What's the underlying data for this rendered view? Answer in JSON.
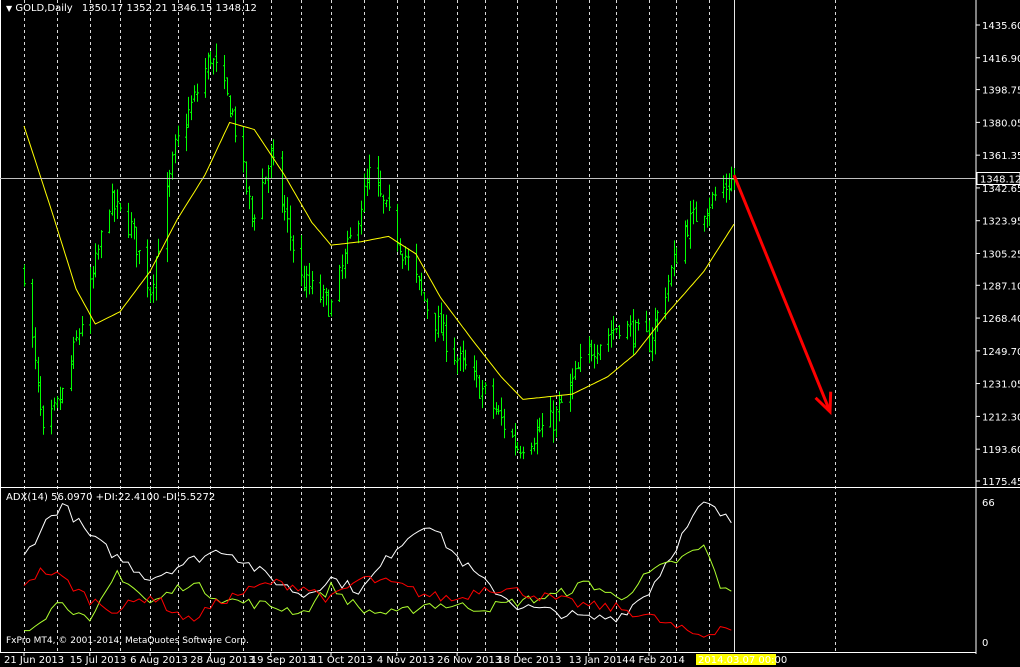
{
  "main_header": {
    "symbol": "GOLD,Daily",
    "ohlc": "1350.17 1352.21 1346.15 1348.12"
  },
  "indicator_header": {
    "label": "ADX(14) 56.0970 +DI:22.4100 -DI:5.5272"
  },
  "copyright": "FxPro MT4, © 2001-2014, MetaQuotes Software Corp.",
  "colors": {
    "background": "#000000",
    "candle_up": "#00ff00",
    "candle_down": "#00ff00",
    "moving_average": "#ffff00",
    "adx_line": "#ffffff",
    "plus_di_line": "#adff2f",
    "minus_di_line": "#ff0000",
    "arrow": "#ff0000",
    "grid": "#ffffff",
    "date_highlight": "#ffff00"
  },
  "current_price_label": "1348.12",
  "current_date_label": "2014.03.07 00:00",
  "chart_data": [
    {
      "type": "candlestick",
      "title": "GOLD,Daily",
      "ylim": [
        1175.45,
        1435.6
      ],
      "y_ticks": [
        "1435.60",
        "1416.90",
        "1398.75",
        "1380.05",
        "1361.35",
        "1342.65",
        "1323.95",
        "1305.25",
        "1287.10",
        "1268.40",
        "1249.70",
        "1231.05",
        "1212.30",
        "1193.60",
        "1175.45"
      ],
      "x_ticks": [
        "21 Jun 2013",
        "15 Jul 2013",
        "6 Aug 2013",
        "28 Aug 2013",
        "19 Sep 2013",
        "11 Oct 2013",
        "4 Nov 2013",
        "26 Nov 2013",
        "18 Dec 2013",
        "13 Jan 2014",
        "4 Feb 2014"
      ],
      "grid": "vertical dashed",
      "close_anchors": [
        {
          "date": "2013-06-21",
          "close": 1295
        },
        {
          "date": "2013-06-28",
          "close": 1200
        },
        {
          "date": "2013-07-05",
          "close": 1225
        },
        {
          "date": "2013-07-15",
          "close": 1285
        },
        {
          "date": "2013-07-22",
          "close": 1335
        },
        {
          "date": "2013-07-30",
          "close": 1320
        },
        {
          "date": "2013-08-06",
          "close": 1285
        },
        {
          "date": "2013-08-15",
          "close": 1365
        },
        {
          "date": "2013-08-28",
          "close": 1418
        },
        {
          "date": "2013-09-05",
          "close": 1385
        },
        {
          "date": "2013-09-12",
          "close": 1325
        },
        {
          "date": "2013-09-19",
          "close": 1360
        },
        {
          "date": "2013-09-30",
          "close": 1290
        },
        {
          "date": "2013-10-11",
          "close": 1275
        },
        {
          "date": "2013-10-25",
          "close": 1350
        },
        {
          "date": "2013-11-04",
          "close": 1315
        },
        {
          "date": "2013-11-15",
          "close": 1275
        },
        {
          "date": "2013-11-26",
          "close": 1245
        },
        {
          "date": "2013-12-06",
          "close": 1225
        },
        {
          "date": "2013-12-18",
          "close": 1195
        },
        {
          "date": "2013-12-31",
          "close": 1210
        },
        {
          "date": "2014-01-13",
          "close": 1250
        },
        {
          "date": "2014-01-24",
          "close": 1265
        },
        {
          "date": "2014-02-04",
          "close": 1255
        },
        {
          "date": "2014-02-17",
          "close": 1320
        },
        {
          "date": "2014-02-26",
          "close": 1335
        },
        {
          "date": "2014-03-07",
          "close": 1348.12
        }
      ],
      "moving_average_anchors": [
        {
          "date": "2013-06-21",
          "value": 1378
        },
        {
          "date": "2013-07-01",
          "value": 1330
        },
        {
          "date": "2013-07-10",
          "value": 1285
        },
        {
          "date": "2013-07-17",
          "value": 1265
        },
        {
          "date": "2013-07-26",
          "value": 1272
        },
        {
          "date": "2013-08-06",
          "value": 1295
        },
        {
          "date": "2013-08-16",
          "value": 1325
        },
        {
          "date": "2013-08-26",
          "value": 1350
        },
        {
          "date": "2013-09-04",
          "value": 1380
        },
        {
          "date": "2013-09-13",
          "value": 1376
        },
        {
          "date": "2013-09-24",
          "value": 1350
        },
        {
          "date": "2013-10-04",
          "value": 1323
        },
        {
          "date": "2013-10-11",
          "value": 1310
        },
        {
          "date": "2013-10-22",
          "value": 1312
        },
        {
          "date": "2013-11-01",
          "value": 1315
        },
        {
          "date": "2013-11-11",
          "value": 1305
        },
        {
          "date": "2013-11-20",
          "value": 1280
        },
        {
          "date": "2013-12-02",
          "value": 1255
        },
        {
          "date": "2013-12-12",
          "value": 1235
        },
        {
          "date": "2013-12-20",
          "value": 1222
        },
        {
          "date": "2014-01-07",
          "value": 1225
        },
        {
          "date": "2014-01-20",
          "value": 1235
        },
        {
          "date": "2014-01-30",
          "value": 1248
        },
        {
          "date": "2014-02-10",
          "value": 1270
        },
        {
          "date": "2014-02-24",
          "value": 1295
        },
        {
          "date": "2014-03-07",
          "value": 1322
        }
      ],
      "annotation": {
        "type": "arrow",
        "from": {
          "date": "2014-03-07",
          "price": 1350
        },
        "to": {
          "date": "2014-04-01",
          "price": 1215
        }
      }
    },
    {
      "type": "line",
      "title": "ADX(14) 56.0970 +DI:22.4100 -DI:5.5272",
      "ylim": [
        0,
        66
      ],
      "y_ticks": [
        "66",
        "0"
      ],
      "series": [
        {
          "name": "ADX(14)",
          "color": "#ffffff",
          "anchors": [
            {
              "date": "2013-06-21",
              "value": 40
            },
            {
              "date": "2013-06-28",
              "value": 55
            },
            {
              "date": "2013-07-05",
              "value": 65
            },
            {
              "date": "2013-07-15",
              "value": 50
            },
            {
              "date": "2013-07-25",
              "value": 40
            },
            {
              "date": "2013-08-06",
              "value": 30
            },
            {
              "date": "2013-08-20",
              "value": 38
            },
            {
              "date": "2013-09-02",
              "value": 44
            },
            {
              "date": "2013-09-19",
              "value": 30
            },
            {
              "date": "2013-10-01",
              "value": 22
            },
            {
              "date": "2013-10-11",
              "value": 30
            },
            {
              "date": "2013-10-22",
              "value": 24
            },
            {
              "date": "2013-11-04",
              "value": 45
            },
            {
              "date": "2013-11-15",
              "value": 57
            },
            {
              "date": "2013-11-26",
              "value": 40
            },
            {
              "date": "2013-12-06",
              "value": 28
            },
            {
              "date": "2013-12-18",
              "value": 17
            },
            {
              "date": "2014-01-01",
              "value": 14
            },
            {
              "date": "2014-01-13",
              "value": 11
            },
            {
              "date": "2014-01-24",
              "value": 12
            },
            {
              "date": "2014-02-04",
              "value": 24
            },
            {
              "date": "2014-02-17",
              "value": 52
            },
            {
              "date": "2014-02-24",
              "value": 66
            },
            {
              "date": "2014-03-03",
              "value": 59
            },
            {
              "date": "2014-03-07",
              "value": 56.097
            }
          ]
        },
        {
          "name": "+DI",
          "color": "#adff2f",
          "anchors": [
            {
              "date": "2013-06-21",
              "value": 6
            },
            {
              "date": "2013-06-28",
              "value": 12
            },
            {
              "date": "2013-07-05",
              "value": 20
            },
            {
              "date": "2013-07-15",
              "value": 8
            },
            {
              "date": "2013-07-25",
              "value": 33
            },
            {
              "date": "2013-08-06",
              "value": 18
            },
            {
              "date": "2013-08-20",
              "value": 28
            },
            {
              "date": "2013-09-02",
              "value": 20
            },
            {
              "date": "2013-09-19",
              "value": 17
            },
            {
              "date": "2013-10-01",
              "value": 14
            },
            {
              "date": "2013-10-11",
              "value": 26
            },
            {
              "date": "2013-10-22",
              "value": 15
            },
            {
              "date": "2013-11-04",
              "value": 13
            },
            {
              "date": "2013-11-15",
              "value": 18
            },
            {
              "date": "2013-11-26",
              "value": 17
            },
            {
              "date": "2013-12-06",
              "value": 16
            },
            {
              "date": "2013-12-18",
              "value": 19
            },
            {
              "date": "2014-01-01",
              "value": 22
            },
            {
              "date": "2014-01-13",
              "value": 28
            },
            {
              "date": "2014-01-24",
              "value": 20
            },
            {
              "date": "2014-02-04",
              "value": 32
            },
            {
              "date": "2014-02-17",
              "value": 40
            },
            {
              "date": "2014-02-24",
              "value": 45
            },
            {
              "date": "2014-03-03",
              "value": 24
            },
            {
              "date": "2014-03-07",
              "value": 22.41
            }
          ]
        },
        {
          "name": "-DI",
          "color": "#ff0000",
          "anchors": [
            {
              "date": "2013-06-21",
              "value": 28
            },
            {
              "date": "2013-06-28",
              "value": 34
            },
            {
              "date": "2013-07-05",
              "value": 30
            },
            {
              "date": "2013-07-15",
              "value": 20
            },
            {
              "date": "2013-07-25",
              "value": 15
            },
            {
              "date": "2013-08-06",
              "value": 22
            },
            {
              "date": "2013-08-20",
              "value": 10
            },
            {
              "date": "2013-09-02",
              "value": 20
            },
            {
              "date": "2013-09-19",
              "value": 28
            },
            {
              "date": "2013-10-01",
              "value": 26
            },
            {
              "date": "2013-10-11",
              "value": 20
            },
            {
              "date": "2013-10-22",
              "value": 30
            },
            {
              "date": "2013-11-04",
              "value": 27
            },
            {
              "date": "2013-11-15",
              "value": 22
            },
            {
              "date": "2013-11-26",
              "value": 20
            },
            {
              "date": "2013-12-06",
              "value": 26
            },
            {
              "date": "2013-12-18",
              "value": 24
            },
            {
              "date": "2014-01-01",
              "value": 20
            },
            {
              "date": "2014-01-13",
              "value": 17
            },
            {
              "date": "2014-01-24",
              "value": 16
            },
            {
              "date": "2014-02-04",
              "value": 12
            },
            {
              "date": "2014-02-17",
              "value": 5
            },
            {
              "date": "2014-02-24",
              "value": 3
            },
            {
              "date": "2014-03-03",
              "value": 8
            },
            {
              "date": "2014-03-07",
              "value": 5.5272
            }
          ]
        }
      ]
    }
  ]
}
